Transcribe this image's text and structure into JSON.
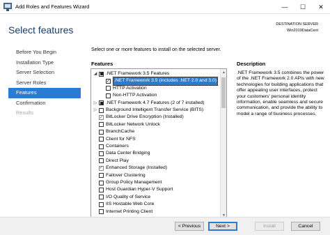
{
  "window": {
    "title": "Add Roles and Features Wizard",
    "controls": {
      "minimize": "—",
      "maximize": "☐",
      "close": "✕"
    }
  },
  "header": {
    "page_title": "Select features",
    "destination_label": "DESTINATION SERVER",
    "destination_value": "Win2019DataCent"
  },
  "nav": {
    "items": [
      {
        "label": "Before You Begin",
        "state": "normal"
      },
      {
        "label": "Installation Type",
        "state": "normal"
      },
      {
        "label": "Server Selection",
        "state": "normal"
      },
      {
        "label": "Server Roles",
        "state": "normal"
      },
      {
        "label": "Features",
        "state": "active"
      },
      {
        "label": "Confirmation",
        "state": "normal"
      },
      {
        "label": "Results",
        "state": "disabled"
      }
    ]
  },
  "main": {
    "instruction": "Select one or more features to install on the selected server.",
    "features_label": "Features",
    "description_label": "Description",
    "description_text": ".NET Framework 3.5 combines the power of the .NET Framework 2.0 APIs with new technologies for building applications that offer appealing user interfaces, protect your customers' personal identity information, enable seamless and secure communication, and provide the ability to model a range of business processes."
  },
  "features": [
    {
      "label": ".NET Framework 3.5 Features",
      "level": 0,
      "expander": "collapse",
      "check": "partial",
      "selected": false
    },
    {
      "label": ".NET Framework 3.5 (includes .NET 2.0 and 3.0)",
      "level": 1,
      "expander": "",
      "check": "checked",
      "selected": true
    },
    {
      "label": "HTTP Activation",
      "level": 1,
      "expander": "",
      "check": "unchecked",
      "selected": false
    },
    {
      "label": "Non-HTTP Activation",
      "level": 1,
      "expander": "",
      "check": "unchecked",
      "selected": false
    },
    {
      "label": ".NET Framework 4.7 Features (2 of 7 installed)",
      "level": 0,
      "expander": "expand",
      "check": "partial",
      "selected": false
    },
    {
      "label": "Background Intelligent Transfer Service (BITS)",
      "level": 0,
      "expander": "expand",
      "check": "unchecked",
      "selected": false
    },
    {
      "label": "BitLocker Drive Encryption (Installed)",
      "level": 0,
      "expander": "",
      "check": "checked-dim",
      "selected": false
    },
    {
      "label": "BitLocker Network Unlock",
      "level": 0,
      "expander": "",
      "check": "unchecked",
      "selected": false
    },
    {
      "label": "BranchCache",
      "level": 0,
      "expander": "",
      "check": "unchecked",
      "selected": false
    },
    {
      "label": "Client for NFS",
      "level": 0,
      "expander": "",
      "check": "unchecked",
      "selected": false
    },
    {
      "label": "Containers",
      "level": 0,
      "expander": "",
      "check": "unchecked",
      "selected": false
    },
    {
      "label": "Data Center Bridging",
      "level": 0,
      "expander": "",
      "check": "unchecked",
      "selected": false
    },
    {
      "label": "Direct Play",
      "level": 0,
      "expander": "",
      "check": "unchecked",
      "selected": false
    },
    {
      "label": "Enhanced Storage (Installed)",
      "level": 0,
      "expander": "",
      "check": "checked-dim",
      "selected": false
    },
    {
      "label": "Failover Clustering",
      "level": 0,
      "expander": "",
      "check": "unchecked",
      "selected": false
    },
    {
      "label": "Group Policy Management",
      "level": 0,
      "expander": "",
      "check": "unchecked",
      "selected": false
    },
    {
      "label": "Host Guardian Hyper-V Support",
      "level": 0,
      "expander": "",
      "check": "unchecked",
      "selected": false
    },
    {
      "label": "I/O Quality of Service",
      "level": 0,
      "expander": "",
      "check": "unchecked",
      "selected": false
    },
    {
      "label": "IIS Hostable Web Core",
      "level": 0,
      "expander": "",
      "check": "unchecked",
      "selected": false
    },
    {
      "label": "Internet Printing Client",
      "level": 0,
      "expander": "",
      "check": "unchecked",
      "selected": false
    }
  ],
  "buttons": {
    "previous": "< Previous",
    "next": "Next >",
    "install": "Install",
    "cancel": "Cancel"
  },
  "colors": {
    "accent": "#2a7bd2",
    "title": "#1a3c6e"
  }
}
